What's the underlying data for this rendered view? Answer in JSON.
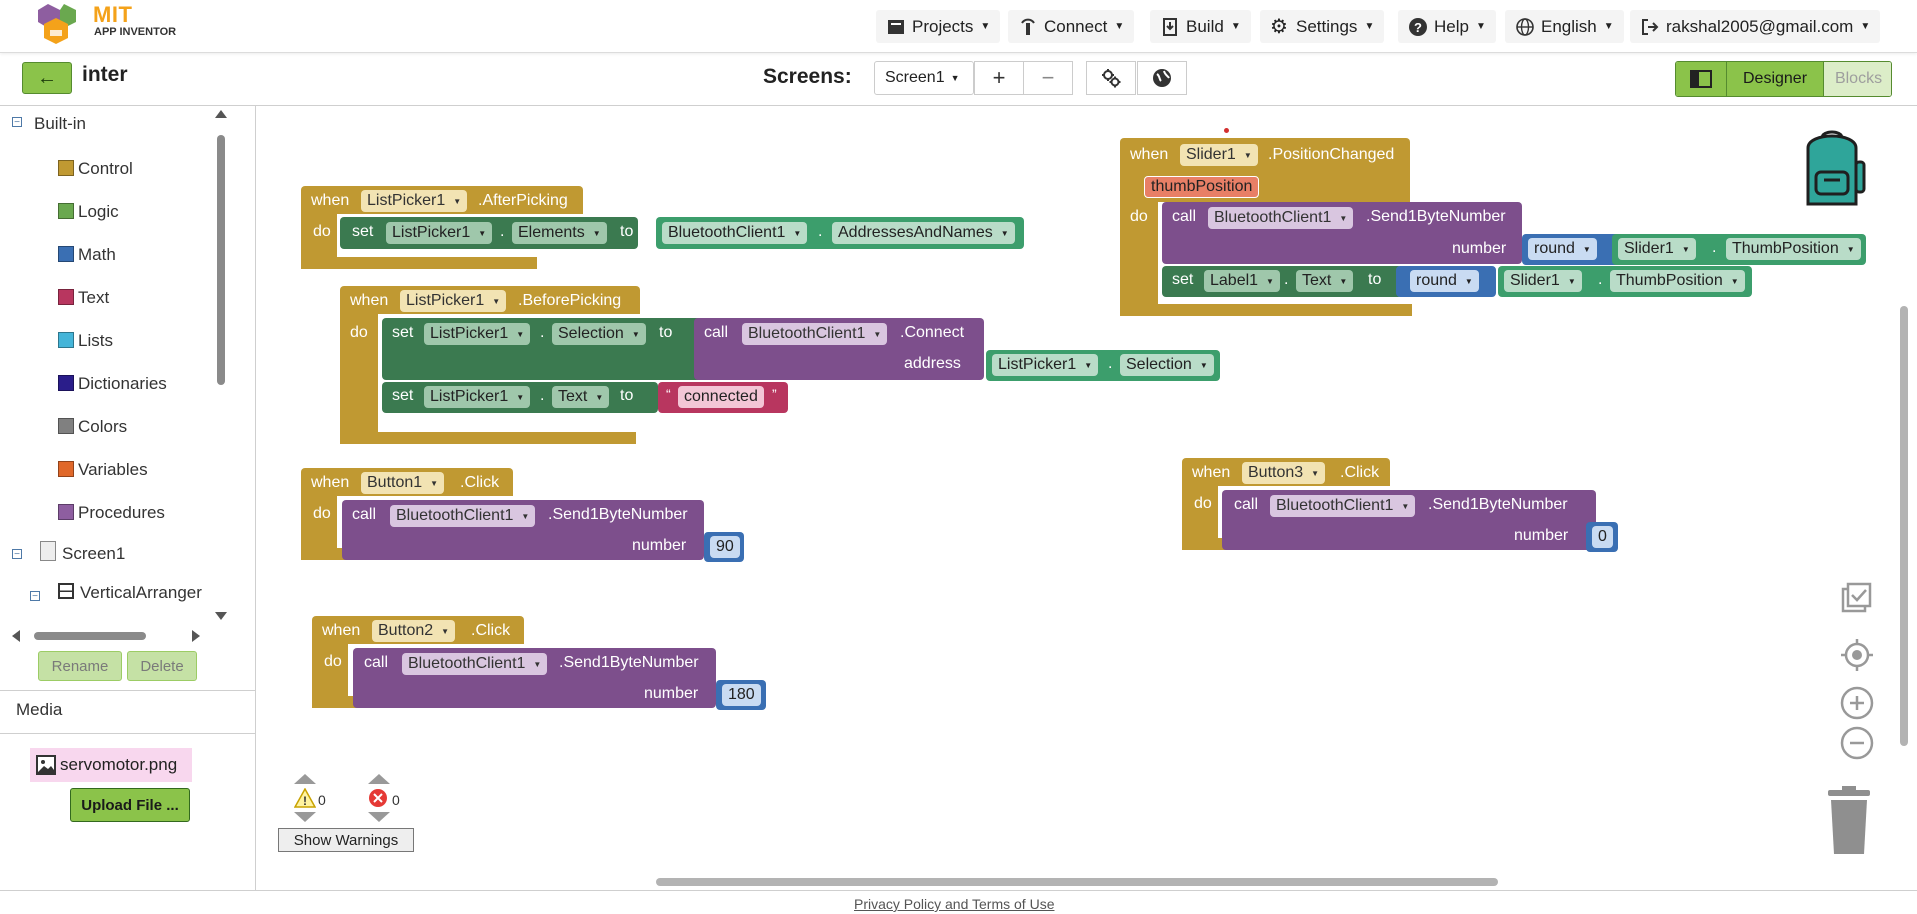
{
  "logo": {
    "title": "MIT",
    "subtitle": "APP INVENTOR"
  },
  "nav": {
    "projects": "Projects",
    "connect": "Connect",
    "build": "Build",
    "settings": "Settings",
    "help": "Help",
    "language": "English",
    "account": "rakshal2005@gmail.com"
  },
  "subbar": {
    "project_name": "inter",
    "screens_label": "Screens:",
    "screen_selected": "Screen1",
    "add_screen": "+",
    "remove_screen": "−",
    "designer": "Designer",
    "blocks": "Blocks"
  },
  "tree": {
    "builtin": "Built-in",
    "items": [
      {
        "label": "Control",
        "color": "#c09932"
      },
      {
        "label": "Logic",
        "color": "#6aa84f"
      },
      {
        "label": "Math",
        "color": "#3a6fb3"
      },
      {
        "label": "Text",
        "color": "#b8365f"
      },
      {
        "label": "Lists",
        "color": "#45b5d9"
      },
      {
        "label": "Dictionaries",
        "color": "#2a1d8a"
      },
      {
        "label": "Colors",
        "color": "#808080"
      },
      {
        "label": "Variables",
        "color": "#e0682a"
      },
      {
        "label": "Procedures",
        "color": "#8e5ea0"
      }
    ],
    "screen": "Screen1",
    "arrangement": "VerticalArranger"
  },
  "left_buttons": {
    "rename": "Rename",
    "delete": "Delete"
  },
  "media": {
    "label": "Media",
    "file": "servomotor.png",
    "upload": "Upload File ..."
  },
  "blocks": {
    "kw_when": "when",
    "kw_do": "do",
    "kw_set": "set",
    "kw_to": "to",
    "kw_call": "call",
    "kw_number": "number",
    "kw_address": "address",
    "kw_dot": ".",
    "b1": {
      "component": "ListPicker1",
      "event": ".AfterPicking",
      "set_comp": "ListPicker1",
      "set_prop": "Elements",
      "val_comp": "BluetoothClient1",
      "val_prop": "AddressesAndNames"
    },
    "b2": {
      "component": "ListPicker1",
      "event": ".BeforePicking",
      "set1_comp": "ListPicker1",
      "set1_prop": "Selection",
      "call_comp": "BluetoothClient1",
      "call_method": ".Connect",
      "addr_comp": "ListPicker1",
      "addr_prop": "Selection",
      "set2_comp": "ListPicker1",
      "set2_prop": "Text",
      "text_value": "connected"
    },
    "b3": {
      "component": "Button1",
      "event": ".Click",
      "call_comp": "BluetoothClient1",
      "call_method": ".Send1ByteNumber",
      "number": "90"
    },
    "b4": {
      "component": "Button2",
      "event": ".Click",
      "call_comp": "BluetoothClient1",
      "call_method": ".Send1ByteNumber",
      "number": "180"
    },
    "b5": {
      "component": "Slider1",
      "event": ".PositionChanged",
      "param": "thumbPosition",
      "call_comp": "BluetoothClient1",
      "call_method": ".Send1ByteNumber",
      "round": "round",
      "num_comp": "Slider1",
      "num_prop": "ThumbPosition",
      "set_comp": "Label1",
      "set_prop": "Text",
      "set_comp2": "Slider1",
      "set_prop2": "ThumbPosition"
    },
    "b6": {
      "component": "Button3",
      "event": ".Click",
      "call_comp": "BluetoothClient1",
      "call_method": ".Send1ByteNumber",
      "number": "0"
    }
  },
  "warnings": {
    "warn_count": "0",
    "error_count": "0",
    "show_warnings": "Show Warnings"
  },
  "footer": {
    "link": "Privacy Policy and Terms of Use"
  }
}
